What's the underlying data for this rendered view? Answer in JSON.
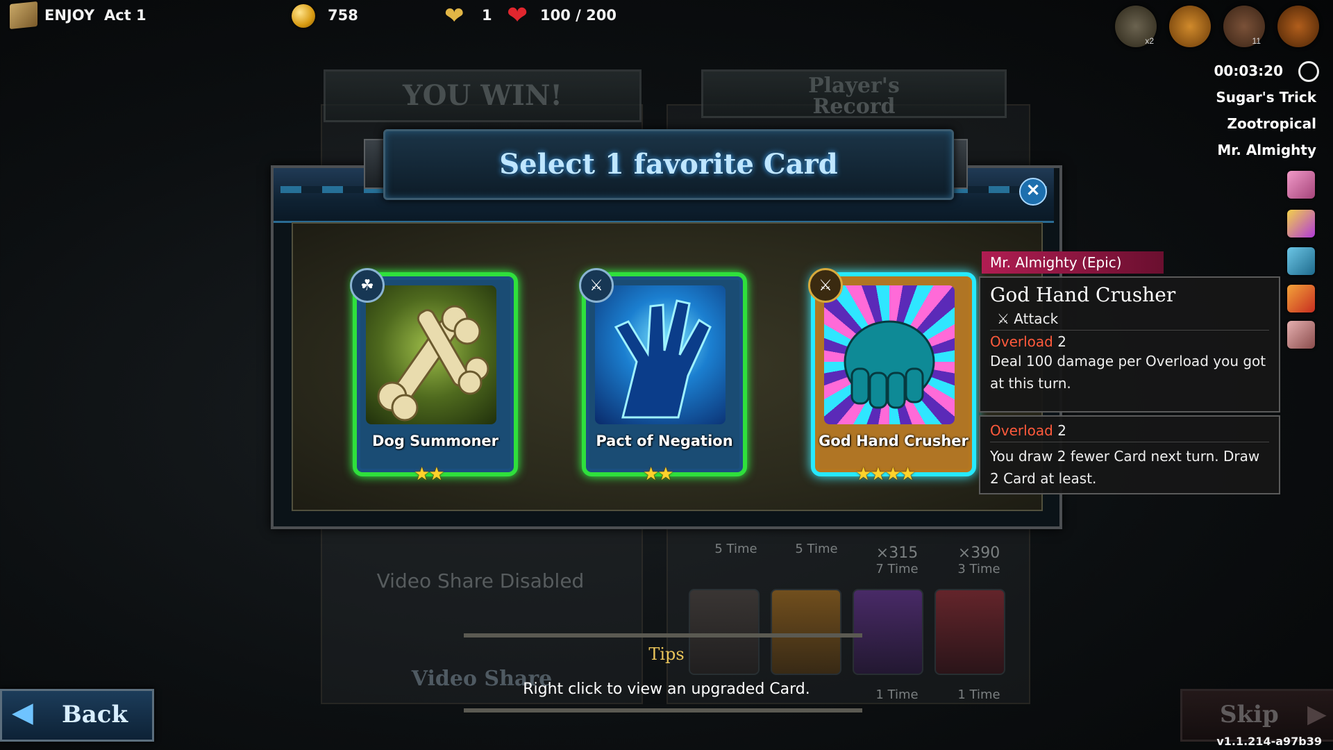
{
  "hud": {
    "game_name": "ENJOY",
    "act_label": "Act 1",
    "gold": "758",
    "lives": "1",
    "hp": "100 / 200",
    "top_icon_badges": [
      "x2",
      "",
      "11",
      ""
    ]
  },
  "timer": "00:03:20",
  "active_effects": [
    "Sugar's Trick",
    "Zootropical",
    "Mr. Almighty"
  ],
  "background": {
    "win_banner": "YOU WIN!",
    "record_banner_line1": "Player's",
    "record_banner_line2": "Record",
    "video_share_disabled": "Video Share Disabled",
    "video_share": "Video Share",
    "record_stats": [
      {
        "count": "",
        "times": "5 Time"
      },
      {
        "count": "",
        "times": "5 Time"
      },
      {
        "count": "⨯315",
        "times": "7 Time"
      },
      {
        "count": "⨯390",
        "times": "3 Time"
      }
    ],
    "bottom_times": [
      "",
      "",
      "1 Time",
      "1 Time"
    ]
  },
  "dialog": {
    "title": "Select 1 favorite Card",
    "close_label": "✕",
    "cards": [
      {
        "name": "Dog Summoner",
        "stars": "★★",
        "type_icon": "paw-icon"
      },
      {
        "name": "Pact of Negation",
        "stars": "★★",
        "type_icon": "sword-icon"
      },
      {
        "name": "God Hand Crusher",
        "stars": "★★★★",
        "type_icon": "sword-icon"
      }
    ]
  },
  "tooltip": {
    "tag": "Mr. Almighty (Epic)",
    "title": "God Hand Crusher",
    "type": "Attack",
    "effect1_keyword": "Overload",
    "effect1_value": " 2",
    "effect1_text": "Deal 100 damage per Overload you got at this turn.",
    "effect2_keyword": "Overload",
    "effect2_value": " 2",
    "effect2_text": "You draw 2 fewer Card next turn. Draw 2 Card at least."
  },
  "tips": {
    "label": "Tips",
    "text": "Right click to view an upgraded Card."
  },
  "buttons": {
    "back": "Back",
    "skip": "Skip"
  },
  "version": "v1.1.214-a97b39",
  "colors": {
    "accent_blue": "#3fa9ff",
    "card_glow_green": "#2fe03c",
    "card_glow_cyan": "#26e9ff",
    "star_gold": "#ffd22b",
    "keyword_red": "#ff5a3c",
    "epic_tag": "#b01d52"
  }
}
